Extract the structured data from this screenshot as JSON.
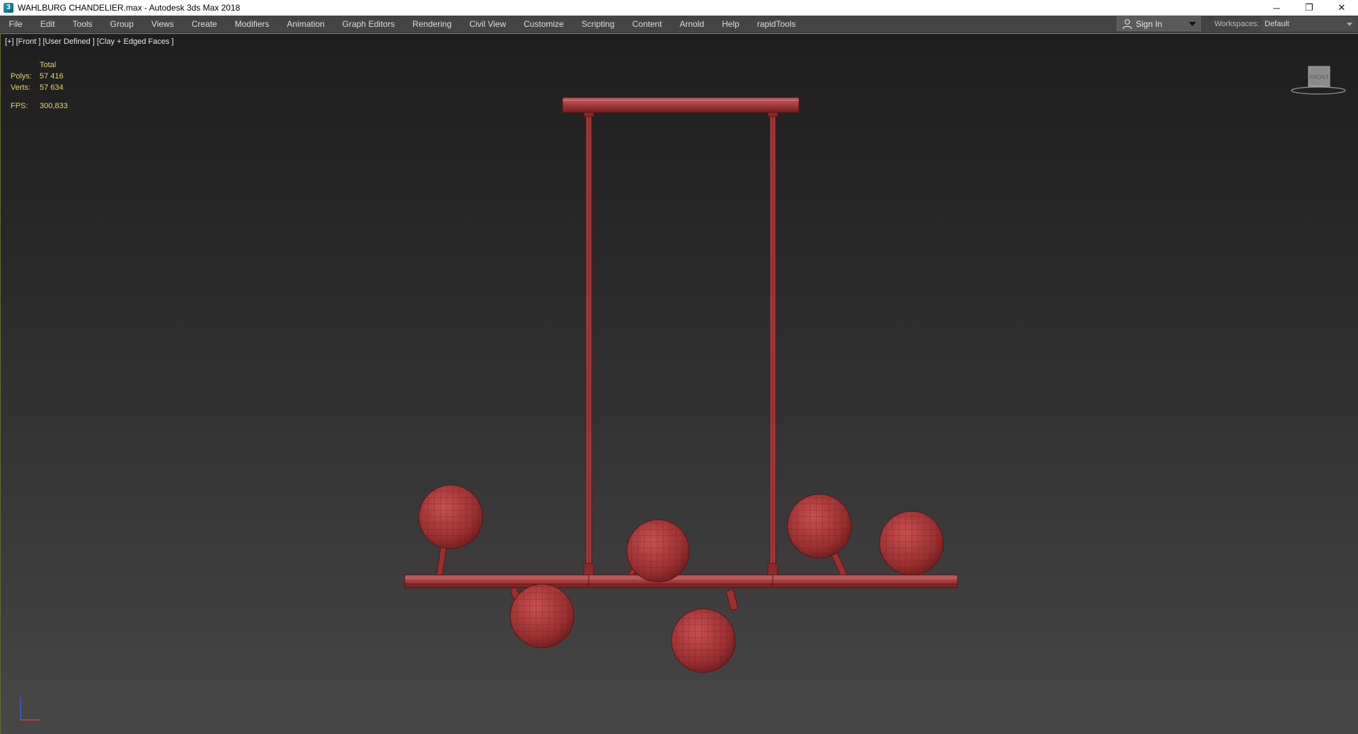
{
  "window": {
    "title": "WAHLBURG CHANDELIER.max - Autodesk 3ds Max 2018",
    "icon": "3dsmax-app-icon",
    "controls": {
      "minimize": "─",
      "restore": "❐",
      "close": "✕"
    }
  },
  "menu": {
    "items": [
      "File",
      "Edit",
      "Tools",
      "Group",
      "Views",
      "Create",
      "Modifiers",
      "Animation",
      "Graph Editors",
      "Rendering",
      "Civil View",
      "Customize",
      "Scripting",
      "Content",
      "Arnold",
      "Help",
      "rapidTools"
    ]
  },
  "account": {
    "sign_in_label": "Sign In"
  },
  "workspace": {
    "label": "Workspaces:",
    "value": "Default"
  },
  "viewport": {
    "label": "[+] [Front ] [User Defined ] [Clay + Edged Faces ]",
    "stats": {
      "header": "Total",
      "polys_label": "Polys:",
      "polys_value": "57 416",
      "verts_label": "Verts:",
      "verts_value": "57 634",
      "fps_label": "FPS:",
      "fps_value": "300,833"
    },
    "viewcube_face": "FRONT",
    "axis_label": "z"
  },
  "colors": {
    "model": "#a83a3a",
    "model_dark": "#6e1e1e",
    "stats_text": "#e6d36a",
    "viewport_border": "#8a8a30"
  }
}
